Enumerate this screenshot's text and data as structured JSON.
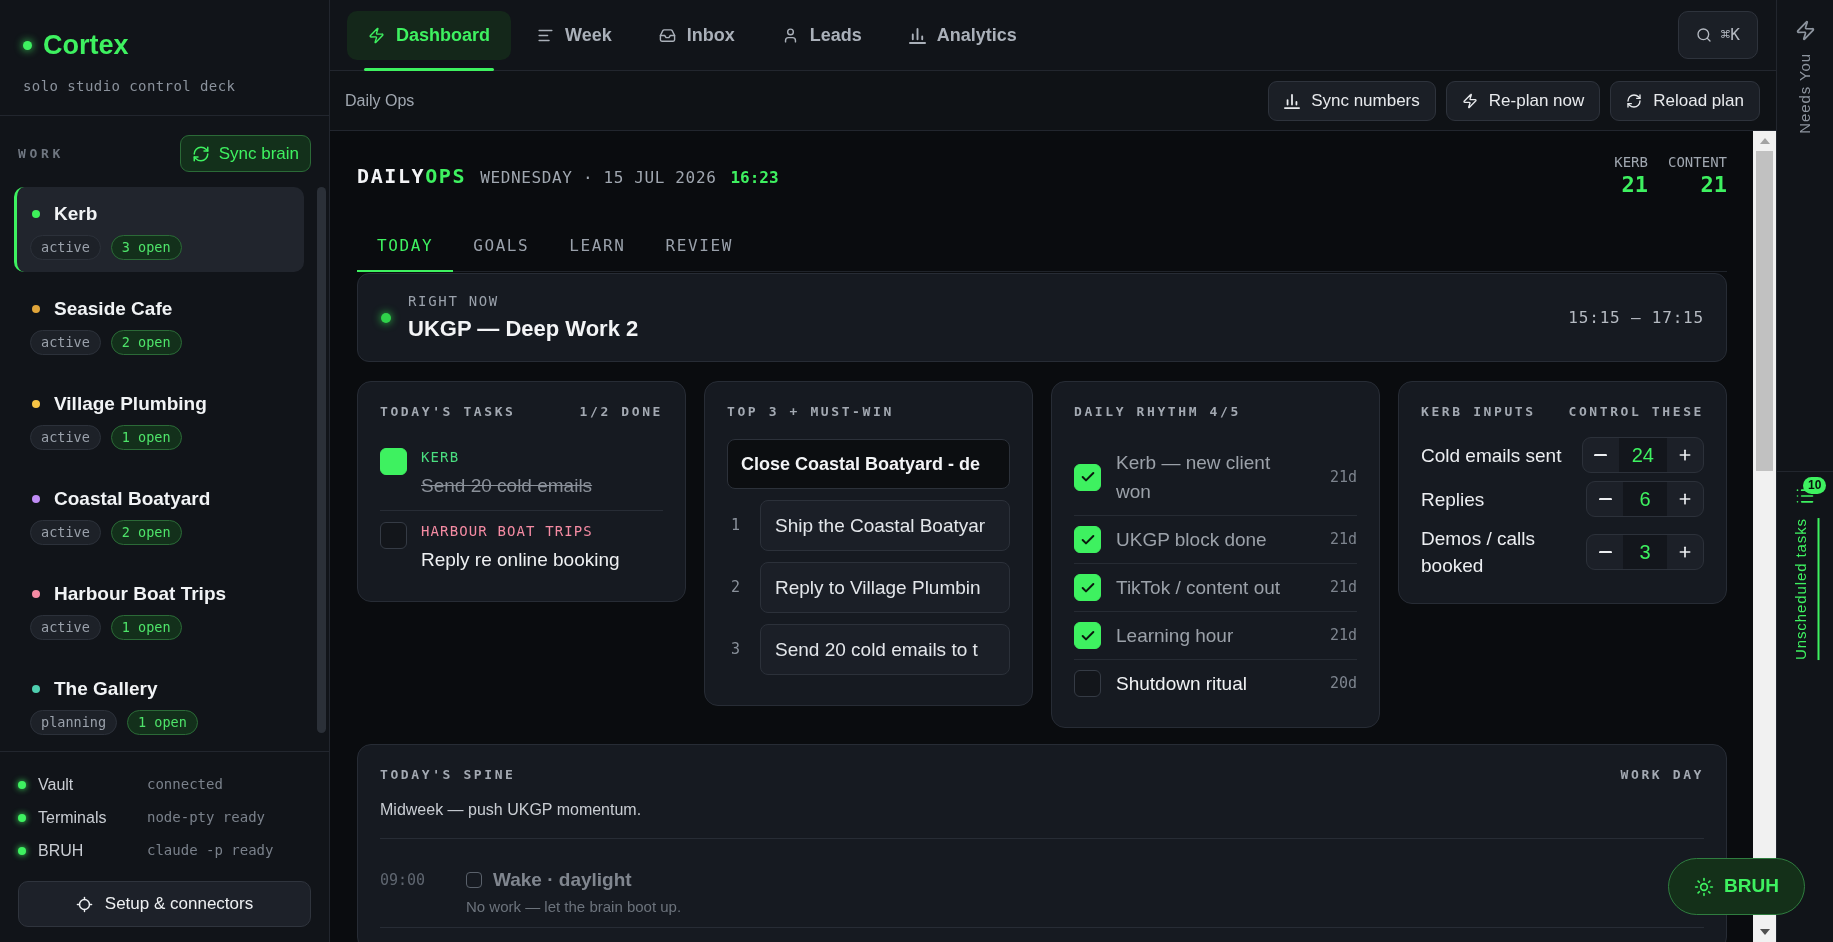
{
  "sidebar": {
    "brand": "Cortex",
    "tagline": "solo studio control deck",
    "section_label": "WORK",
    "sync_button": "Sync brain",
    "projects": [
      {
        "name": "Kerb",
        "color": "#3ef15a",
        "status": "active",
        "open": "3 open",
        "selected": true
      },
      {
        "name": "Seaside Cafe",
        "color": "#e0a53a",
        "status": "active",
        "open": "2 open",
        "selected": false
      },
      {
        "name": "Village Plumbing",
        "color": "#f6c445",
        "status": "active",
        "open": "1 open",
        "selected": false
      },
      {
        "name": "Coastal Boatyard",
        "color": "#c08cf5",
        "status": "active",
        "open": "2 open",
        "selected": false
      },
      {
        "name": "Harbour Boat Trips",
        "color": "#f58ba3",
        "status": "active",
        "open": "1 open",
        "selected": false
      },
      {
        "name": "The Gallery",
        "color": "#4fcfb0",
        "status": "planning",
        "open": "1 open",
        "selected": false
      }
    ],
    "services": [
      {
        "name": "Vault",
        "status": "connected"
      },
      {
        "name": "Terminals",
        "status": "node-pty ready"
      },
      {
        "name": "BRUH",
        "status": "claude -p ready"
      }
    ],
    "setup_button": "Setup & connectors"
  },
  "nav": {
    "tabs": [
      {
        "label": "Dashboard",
        "selected": true
      },
      {
        "label": "Week",
        "selected": false
      },
      {
        "label": "Inbox",
        "selected": false
      },
      {
        "label": "Leads",
        "selected": false
      },
      {
        "label": "Analytics",
        "selected": false
      }
    ],
    "search_shortcut": "⌘K"
  },
  "toolbar": {
    "title": "Daily Ops",
    "actions": [
      "Sync numbers",
      "Re-plan now",
      "Reload plan"
    ]
  },
  "header": {
    "title": "DAILY",
    "title_accent": "OPS",
    "date": "WEDNESDAY · 15 JUL 2026",
    "time": "16:23",
    "stats": [
      {
        "label": "KERB",
        "value": "21"
      },
      {
        "label": "CONTENT",
        "value": "21"
      }
    ]
  },
  "tabs": [
    {
      "label": "TODAY",
      "selected": true
    },
    {
      "label": "GOALS",
      "selected": false
    },
    {
      "label": "LEARN",
      "selected": false
    },
    {
      "label": "REVIEW",
      "selected": false
    }
  ],
  "right_now": {
    "label": "RIGHT NOW",
    "title": "UKGP — Deep Work 2",
    "time": "15:15 – 17:15"
  },
  "tasks": {
    "title": "TODAY'S TASKS",
    "progress": "1/2 DONE",
    "items": [
      {
        "project": "KERB",
        "color": "#4ade80",
        "text": "Send 20 cold emails",
        "checked": true
      },
      {
        "project": "HARBOUR BOAT TRIPS",
        "color": "#f58ba3",
        "text": "Reply re online booking",
        "checked": false
      }
    ]
  },
  "top3": {
    "title": "TOP 3 + MUST-WIN",
    "must_win": "Close Coastal Boatyard - de",
    "items": [
      {
        "number": "1",
        "value": "Ship the Coastal Boatyar"
      },
      {
        "number": "2",
        "value": "Reply to Village Plumbin"
      },
      {
        "number": "3",
        "value": "Send 20 cold emails to t"
      }
    ]
  },
  "rhythm": {
    "title": "DAILY RHYTHM 4/5",
    "items": [
      {
        "label": "Kerb — new client won",
        "streak": "21d",
        "checked": true
      },
      {
        "label": "UKGP block done",
        "streak": "21d",
        "checked": true
      },
      {
        "label": "TikTok / content out",
        "streak": "21d",
        "checked": true
      },
      {
        "label": "Learning hour",
        "streak": "21d",
        "checked": true
      },
      {
        "label": "Shutdown ritual",
        "streak": "20d",
        "checked": false
      }
    ]
  },
  "inputs": {
    "title": "KERB INPUTS",
    "subtitle": "CONTROL THESE",
    "items": [
      {
        "label": "Cold emails sent",
        "value": "24"
      },
      {
        "label": "Replies",
        "value": "6"
      },
      {
        "label": "Demos / calls booked",
        "value": "3"
      }
    ]
  },
  "spine": {
    "title": "TODAY'S SPINE",
    "mode": "WORK DAY",
    "note": "Midweek — push UKGP momentum.",
    "items": [
      {
        "time": "09:00",
        "title": "Wake · daylight",
        "detail": "No work — let the brain boot up.",
        "checked": false,
        "past": true
      }
    ]
  },
  "rail": [
    {
      "label": "Needs You",
      "selected": false
    },
    {
      "label": "Unscheduled tasks",
      "badge": "10",
      "selected": true
    }
  ],
  "assistant_button": "BRUH"
}
